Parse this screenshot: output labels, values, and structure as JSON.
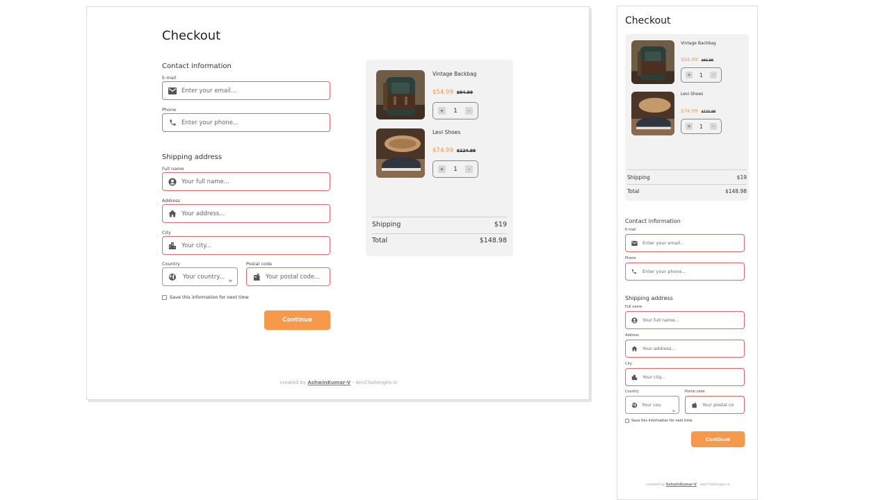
{
  "page": {
    "title": "Checkout"
  },
  "contact": {
    "heading": "Contact information",
    "email_label": "E-mail",
    "email_placeholder": "Enter your email...",
    "phone_label": "Phone",
    "phone_placeholder": "Enter your phone..."
  },
  "shipping": {
    "heading": "Shipping address",
    "fullname_label": "Full name",
    "fullname_placeholder": "Your full name...",
    "address_label": "Address",
    "address_placeholder": "Your address...",
    "city_label": "City",
    "city_placeholder": "Your city...",
    "country_label": "Country",
    "country_placeholder": "Your country...",
    "country_placeholder_mobile": "Your cou",
    "postal_label": "Postal code",
    "postal_placeholder": "Your postal code...",
    "postal_placeholder_mobile": "Your postal co",
    "save_label": "Save this information for next time"
  },
  "continue_label": "Continue",
  "cart": {
    "items": [
      {
        "name": "Vintage Backbag",
        "price": "$54.99",
        "old_price": "$94.99",
        "qty": "1",
        "minus": "-",
        "plus": "+"
      },
      {
        "name": "Levi Shoes",
        "price": "$74.99",
        "old_price": "$124.99",
        "qty": "1",
        "minus": "-",
        "plus": "+"
      }
    ],
    "shipping_label": "Shipping",
    "shipping_value": "$19",
    "total_label": "Total",
    "total_value": "$148.98"
  },
  "footer": {
    "prefix": "created by",
    "author": "AshwinKumar-V",
    "suffix": "- devChallenges.io"
  },
  "colors": {
    "accent": "#f7994a",
    "field_border": "#e0686a",
    "panel_bg": "#f2f2f2"
  },
  "icons": [
    "mail-icon",
    "phone-icon",
    "user-circle-icon",
    "home-icon",
    "city-icon",
    "globe-icon",
    "mailbox-icon",
    "chevron-down-icon"
  ]
}
